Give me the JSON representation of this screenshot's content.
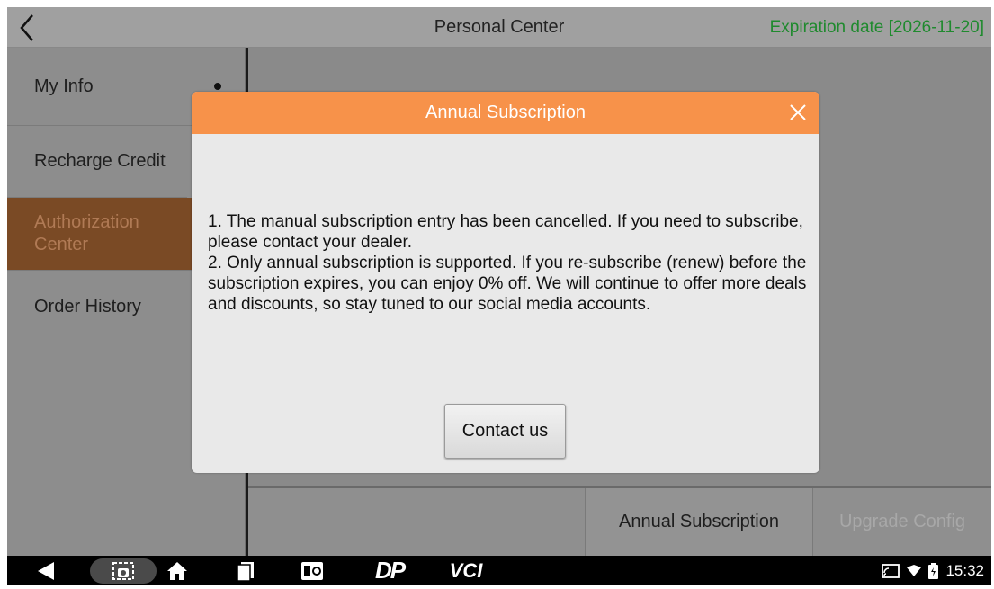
{
  "header": {
    "title": "Personal Center",
    "expiration": "Expiration date [2026-11-20]",
    "expiration_color": "#1f8a2e"
  },
  "sidebar": {
    "items": [
      {
        "label": "My Info",
        "icon": "dot-indicator"
      },
      {
        "label": "Recharge Credit"
      },
      {
        "label": "Authorization Center",
        "active": true
      },
      {
        "label": "Order History"
      }
    ]
  },
  "bottom_tabs": {
    "items": [
      {
        "label": "Annual Subscription"
      },
      {
        "label": "Upgrade Config",
        "disabled": true
      }
    ]
  },
  "dialog": {
    "title": "Annual Subscription",
    "header_color": "#f7924a",
    "paragraphs": [
      "1. The manual subscription entry has been cancelled. If you need to subscribe, please contact your dealer.",
      "2. Only annual subscription is supported. If you re-subscribe (renew) before the subscription expires, you can enjoy 0% off. We will continue to offer more deals and discounts, so stay tuned to our social media accounts."
    ],
    "button_label": "Contact us",
    "close_icon": "close-icon"
  },
  "navbar": {
    "icons": [
      "back-triangle-icon",
      "screenshot-icon",
      "home-icon",
      "recent-apps-icon",
      "app-shortcut-icon",
      "dp-logo-icon",
      "vci-logo-icon"
    ],
    "dp_label": "DP",
    "vci_label": "VCI",
    "time": "15:32",
    "status_icons": [
      "cast-icon",
      "wifi-icon",
      "battery-icon"
    ]
  }
}
